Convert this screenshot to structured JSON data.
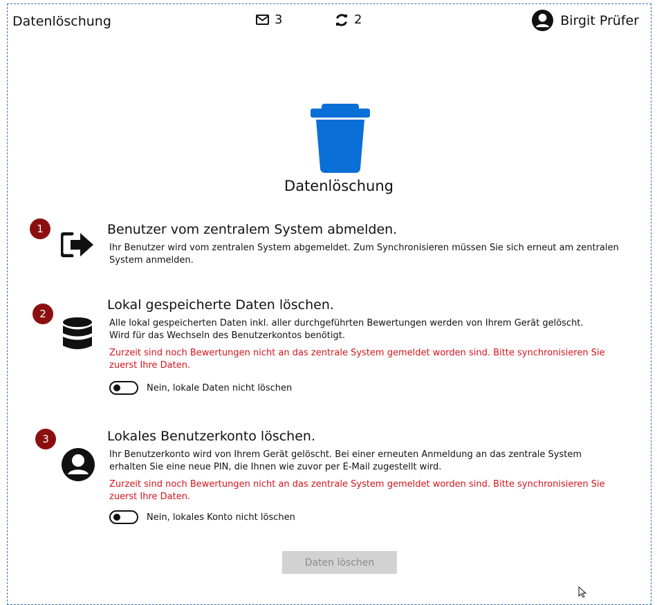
{
  "header": {
    "title": "Datenlöschung",
    "messages_count": "3",
    "sync_count": "2",
    "user_name": "Birgit Prüfer"
  },
  "hero": {
    "icon": "trash-icon",
    "title": "Datenlöschung"
  },
  "sections": [
    {
      "number": "1",
      "icon": "sign-out-icon",
      "title": "Benutzer vom zentralem System abmelden.",
      "description": "Ihr Benutzer wird vom zentralen System abgemeldet. Zum Synchronisieren müssen Sie sich erneut am zentralen System anmelden."
    },
    {
      "number": "2",
      "icon": "database-icon",
      "title": "Lokal gespeicherte Daten löschen.",
      "description_line1": "Alle lokal gespeicherten Daten inkl. aller durchgeführten Bewertungen werden von Ihrem Gerät gelöscht.",
      "description_line2": "Wird für das Wechseln des Benutzerkontos benötigt.",
      "warning": "Zurzeit sind noch Bewertungen nicht an das zentrale System gemeldet worden sind. Bitte synchronisieren Sie zuerst Ihre Daten.",
      "toggle_label": "Nein, lokale Daten nicht löschen"
    },
    {
      "number": "3",
      "icon": "user-circle-icon",
      "title": "Lokales Benutzerkonto löschen.",
      "description": "Ihr Benutzerkonto wird von Ihrem Gerät gelöscht. Bei einer erneuten Anmeldung an das zentrale System erhalten Sie eine neue PIN, die Ihnen wie zuvor per E-Mail zugestellt wird.",
      "warning": "Zurzeit sind noch Bewertungen nicht an das zentrale System gemeldet worden sind. Bitte synchronisieren Sie zuerst Ihre Daten.",
      "toggle_label": "Nein, lokales Konto nicht löschen"
    }
  ],
  "actions": {
    "delete_label": "Daten löschen"
  },
  "colors": {
    "accent_blue": "#0a6fd6",
    "badge_red": "#8c0f0f",
    "warning_red": "#d4131b",
    "disabled_button": "#d2d2d2"
  }
}
